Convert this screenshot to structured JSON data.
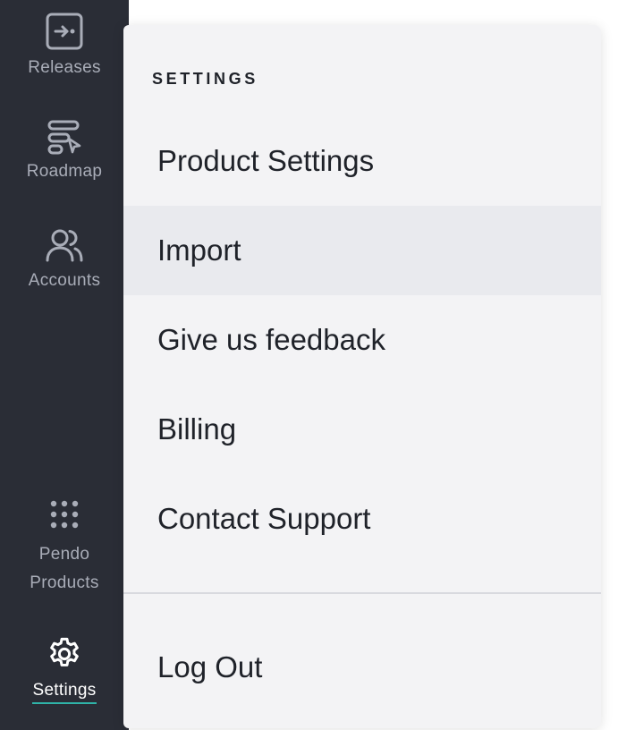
{
  "sidebar": {
    "items": [
      {
        "label": "Releases",
        "icon": "releases-icon"
      },
      {
        "label": "Roadmap",
        "icon": "roadmap-icon"
      },
      {
        "label": "Accounts",
        "icon": "accounts-icon"
      },
      {
        "label": "Pendo\nProducts",
        "icon": "grid-dots-icon"
      },
      {
        "label": "Settings",
        "icon": "gear-icon",
        "active": true
      }
    ],
    "background": "#2a2d36",
    "active_underline_color": "#2fb3a8"
  },
  "settings_menu": {
    "heading": "SETTINGS",
    "items": [
      {
        "label": "Product Settings"
      },
      {
        "label": "Import",
        "hovered": true
      },
      {
        "label": "Give us feedback"
      },
      {
        "label": "Billing"
      },
      {
        "label": "Contact Support"
      }
    ],
    "logout_label": "Log Out"
  }
}
